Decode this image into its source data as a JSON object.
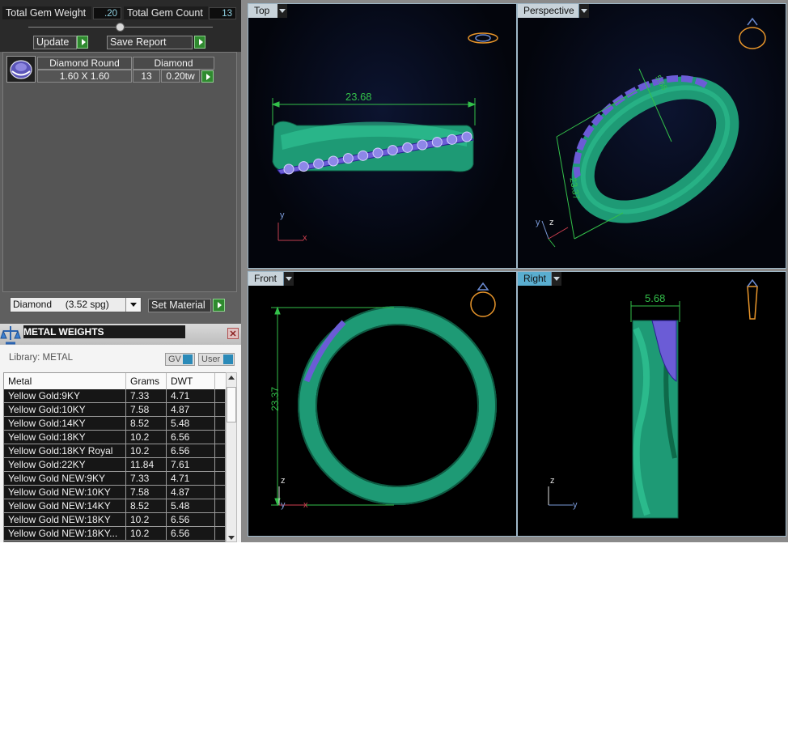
{
  "summary": {
    "weight_label": "Total Gem Weight",
    "weight_value": ".20",
    "count_label": "Total Gem Count",
    "count_value": "13"
  },
  "actions": {
    "update_label": "Update",
    "save_report_label": "Save Report"
  },
  "gem_table": {
    "shape_header": "Diamond Round",
    "size": "1.60 X 1.60",
    "material_header": "Diamond",
    "count": "13",
    "weight": "0.20tw"
  },
  "material": {
    "selected": "Diamond     (3.52 spg)",
    "set_label": "Set Material"
  },
  "metal_weights": {
    "title": "METAL WEIGHTS",
    "library_label": "Library: METAL",
    "gv_label": "GV",
    "user_label": "User",
    "columns": [
      "Metal",
      "Grams",
      "DWT"
    ],
    "rows": [
      {
        "metal": "Yellow Gold:9KY",
        "grams": "7.33",
        "dwt": "4.71"
      },
      {
        "metal": "Yellow Gold:10KY",
        "grams": "7.58",
        "dwt": "4.87"
      },
      {
        "metal": "Yellow Gold:14KY",
        "grams": "8.52",
        "dwt": "5.48"
      },
      {
        "metal": "Yellow Gold:18KY",
        "grams": "10.2",
        "dwt": "6.56"
      },
      {
        "metal": "Yellow Gold:18KY Royal",
        "grams": "10.2",
        "dwt": "6.56"
      },
      {
        "metal": "Yellow Gold:22KY",
        "grams": "11.84",
        "dwt": "7.61"
      },
      {
        "metal": "Yellow Gold NEW:9KY",
        "grams": "7.33",
        "dwt": "4.71"
      },
      {
        "metal": "Yellow Gold NEW:10KY",
        "grams": "7.58",
        "dwt": "4.87"
      },
      {
        "metal": "Yellow Gold NEW:14KY",
        "grams": "8.52",
        "dwt": "5.48"
      },
      {
        "metal": "Yellow Gold NEW:18KY",
        "grams": "10.2",
        "dwt": "6.56"
      },
      {
        "metal": "Yellow Gold NEW:18KY...",
        "grams": "10.2",
        "dwt": "6.56"
      }
    ]
  },
  "viewports": {
    "top": {
      "label": "Top",
      "dimension": "23.68",
      "axis_v": "y",
      "axis_h": "x"
    },
    "perspective": {
      "label": "Perspective",
      "dimension_a": "23.37",
      "dimension_b": "5.68",
      "axis_v": "y",
      "axis_h": "z"
    },
    "front": {
      "label": "Front",
      "dimension": "23.37",
      "axis_v": "z",
      "axis_h": "x",
      "axis_o": "y"
    },
    "right": {
      "label": "Right",
      "dimension": "5.68",
      "axis_v": "z",
      "axis_h": "y"
    }
  },
  "colors": {
    "metal": "#1d8f6a",
    "gem": "#6b5cd6",
    "dimension_line": "#33c04a",
    "label_active": "#5aaed0",
    "label_inactive": "#c8d3da"
  }
}
